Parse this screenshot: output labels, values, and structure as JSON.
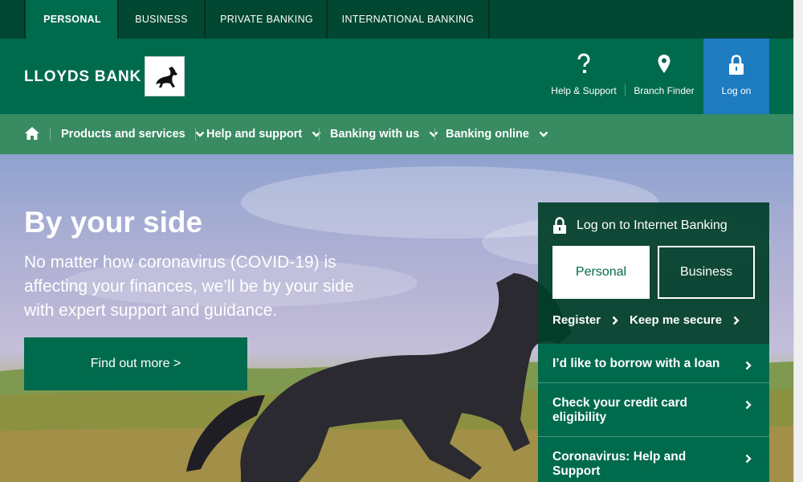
{
  "top_tabs": [
    {
      "label": "PERSONAL",
      "active": true
    },
    {
      "label": "BUSINESS",
      "active": false
    },
    {
      "label": "PRIVATE BANKING",
      "active": false
    },
    {
      "label": "INTERNATIONAL BANKING",
      "active": false
    }
  ],
  "header": {
    "brand": "LLOYDS BANK",
    "help_label": "Help & Support",
    "branch_label": "Branch Finder",
    "logon_label": "Log on"
  },
  "nav": {
    "items": [
      "Products and services",
      "Help and support",
      "Banking with us",
      "Banking online"
    ]
  },
  "hero": {
    "title": "By your side",
    "text": "No matter how coronavirus (COVID-19) is affecting your finances, we’ll be by your side with expert support and guidance.",
    "cta": "Find out more >"
  },
  "login_panel": {
    "title": "Log on to Internet Banking",
    "personal": "Personal",
    "business": "Business",
    "register": "Register",
    "keep_secure": "Keep me secure"
  },
  "quick_links": [
    "I’d like to borrow with a loan",
    "Check your credit card eligibility",
    "Coronavirus: Help and Support"
  ],
  "colors": {
    "brand_green": "#006a4d",
    "dark_green": "#024731",
    "nav_green": "#398b62",
    "logon_blue": "#1d7bbf"
  }
}
